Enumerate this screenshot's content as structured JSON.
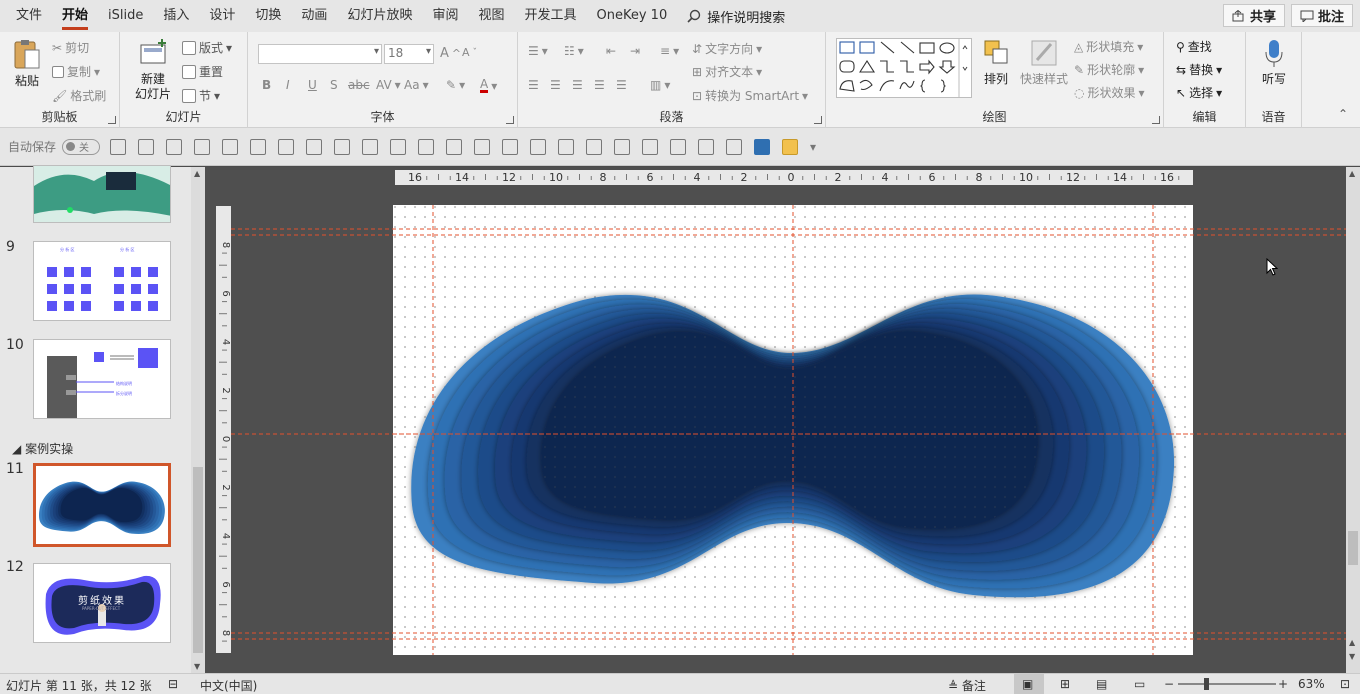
{
  "tabs": [
    "文件",
    "开始",
    "iSlide",
    "插入",
    "设计",
    "切换",
    "动画",
    "幻灯片放映",
    "审阅",
    "视图",
    "开发工具",
    "OneKey 10"
  ],
  "search_label": "操作说明搜索",
  "share_label": "共享",
  "comment_label": "批注",
  "clipboard": {
    "paste": "粘贴",
    "cut": "剪切",
    "copy": "复制",
    "format_painter": "格式刷",
    "label": "剪贴板"
  },
  "slides_group": {
    "new_slide_line1": "新建",
    "new_slide_line2": "幻灯片",
    "layout": "版式",
    "reset": "重置",
    "section": "节",
    "label": "幻灯片"
  },
  "font": {
    "size": "18",
    "label": "字体",
    "bold": "B",
    "italic": "I",
    "underline": "U",
    "shadow": "S",
    "strike": "abc",
    "case": "Aa",
    "grow": "A",
    "shrink": "A"
  },
  "paragraph": {
    "text_direction": "文字方向",
    "align_text": "对齐文本",
    "convert_smartart": "转换为 SmartArt",
    "label": "段落"
  },
  "drawing": {
    "arrange": "排列",
    "quick_styles": "快速样式",
    "fill": "形状填充",
    "outline": "形状轮廓",
    "effects": "形状效果",
    "label": "绘图"
  },
  "editing": {
    "find": "查找",
    "replace": "替换",
    "select": "选择",
    "label": "编辑"
  },
  "voice": {
    "dictate": "听写",
    "label": "语音"
  },
  "autosave": {
    "label": "自动保存",
    "state": "关"
  },
  "panel": {
    "section": "案例实操",
    "slides": [
      {
        "num": "9",
        "title_left": "分 析 区",
        "title_right": "分 析 区"
      },
      {
        "num": "10",
        "title": "",
        "legend1": "结构说明",
        "legend2": "拆分说明"
      },
      {
        "num": "11",
        "title": ""
      },
      {
        "num": "12",
        "title": "剪纸效果",
        "subtitle": "PAPER-CUT EFFECT"
      }
    ]
  },
  "ruler": {
    "h": [
      "16",
      "14",
      "12",
      "10",
      "8",
      "6",
      "4",
      "2",
      "0",
      "2",
      "4",
      "6",
      "8",
      "10",
      "12",
      "14",
      "16"
    ],
    "v": [
      "8",
      "6",
      "4",
      "2",
      "0",
      "2",
      "4",
      "6",
      "8"
    ]
  },
  "colors": {
    "layers": [
      "#3a80c2",
      "#2f71b4",
      "#2a64a6",
      "#245898",
      "#1f4c89",
      "#1b417b",
      "#163970",
      "#123061",
      "#0d2550"
    ]
  },
  "status": {
    "slide_info": "幻灯片 第 11 张，共 12 张",
    "language": "中文(中国)",
    "notes": "备注",
    "zoom": "63%"
  }
}
